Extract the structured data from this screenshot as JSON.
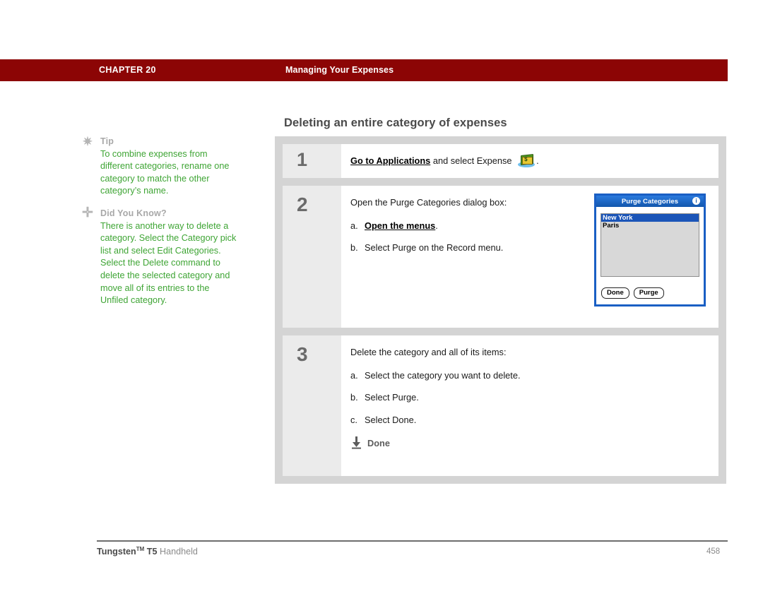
{
  "header": {
    "chapter": "CHAPTER 20",
    "section": "Managing Your Expenses",
    "bar_color": "#8c0505"
  },
  "page": {
    "heading": "Deleting an entire category of expenses",
    "heading_color": "#4a4a4a"
  },
  "sidebar": {
    "blocks": [
      {
        "bullet_icon": "asterisk-icon",
        "bullet_glyph": "✷",
        "heading": "Tip",
        "body": "To combine expenses from different categories, rename one category to match the other category’s name.",
        "text_color": "#3fa535"
      },
      {
        "bullet_icon": "plus-icon",
        "bullet_glyph": "✛",
        "heading": "Did You Know?",
        "body": "There is another way to delete a category. Select the Category pick list and select Edit Categories. Select the Delete command to delete the selected category and move all of its entries to the Unfiled category.",
        "text_color": "#3fa535"
      }
    ]
  },
  "steps": [
    {
      "number": "1",
      "lead_link": "Go to Applications",
      "lead_rest": " and select Expense",
      "lead_tail": ".",
      "icon": "expense-wallet-icon"
    },
    {
      "number": "2",
      "lead": "Open the Purge Categories dialog box:",
      "items": [
        {
          "marker": "a.",
          "bold_link": "Open the menus",
          "tail": "."
        },
        {
          "marker": "b.",
          "text": "Select Purge on the Record menu."
        }
      ]
    },
    {
      "number": "3",
      "lead": "Delete the category and all of its items:",
      "items": [
        {
          "marker": "a.",
          "text": "Select the category you want to delete."
        },
        {
          "marker": "b.",
          "text": "Select Purge."
        },
        {
          "marker": "c.",
          "text": "Select Done."
        }
      ],
      "done_label": "Done",
      "done_icon": "download-arrow-icon"
    }
  ],
  "pda_dialog": {
    "title": "Purge Categories",
    "info_icon": "info-icon",
    "info_glyph": "i",
    "title_bar_color": "#1f6fd0",
    "border_color": "#1a5fc4",
    "list": [
      {
        "label": "New York",
        "selected": true
      },
      {
        "label": "Paris",
        "selected": false
      }
    ],
    "buttons": [
      {
        "label": "Done"
      },
      {
        "label": "Purge"
      }
    ]
  },
  "footer": {
    "product_bold": "Tungsten",
    "product_tm": "TM",
    "product_model": " T5 ",
    "product_rest": "Handheld",
    "page_number": "458"
  }
}
